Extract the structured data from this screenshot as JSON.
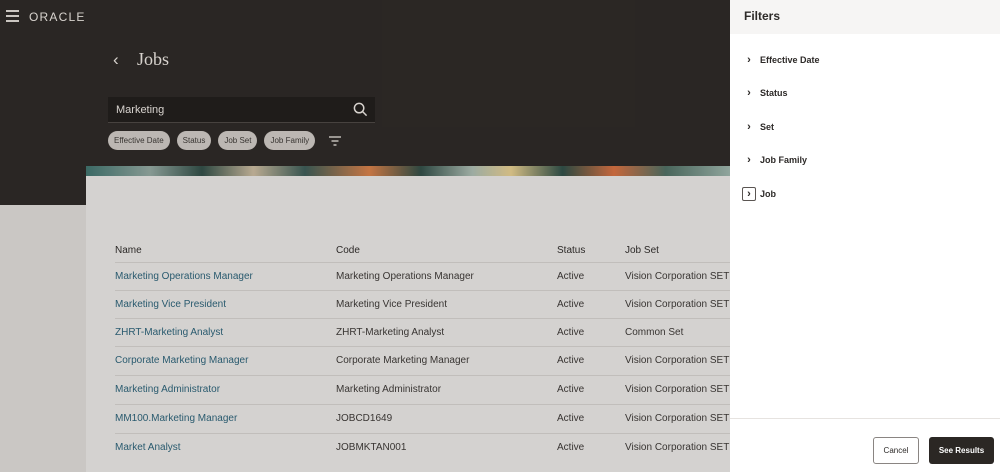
{
  "app": {
    "logo": "ORACLE"
  },
  "header": {
    "back_label": "‹",
    "title": "Jobs"
  },
  "search": {
    "value": "Marketing",
    "icon": "search-icon"
  },
  "chips": [
    "Effective Date",
    "Status",
    "Job Set",
    "Job Family"
  ],
  "table": {
    "headers": [
      "Name",
      "Code",
      "Status",
      "Job Set"
    ],
    "rows": [
      [
        "Marketing Operations Manager",
        "Marketing Operations Manager",
        "Active",
        "Vision Corporation SET"
      ],
      [
        "Marketing Vice President",
        "Marketing Vice President",
        "Active",
        "Vision Corporation SET"
      ],
      [
        "ZHRT-Marketing Analyst",
        "ZHRT-Marketing Analyst",
        "Active",
        "Common Set"
      ],
      [
        "Corporate Marketing Manager",
        "Corporate Marketing Manager",
        "Active",
        "Vision Corporation SET"
      ],
      [
        "Marketing Administrator",
        "Marketing Administrator",
        "Active",
        "Vision Corporation SET"
      ],
      [
        "MM100.Marketing Manager",
        "JOBCD1649",
        "Active",
        "Vision Corporation SET"
      ],
      [
        "Market Analyst",
        "JOBMKTAN001",
        "Active",
        "Vision Corporation SET"
      ]
    ]
  },
  "filters_panel": {
    "title": "Filters",
    "items": [
      "Effective Date",
      "Status",
      "Set",
      "Job Family",
      "Job"
    ],
    "cancel_label": "Cancel",
    "see_results_label": "See Results"
  },
  "colors": {
    "dark_bg": "#2b2724",
    "link": "#2a5f75",
    "primary_button": "#2b2724"
  }
}
